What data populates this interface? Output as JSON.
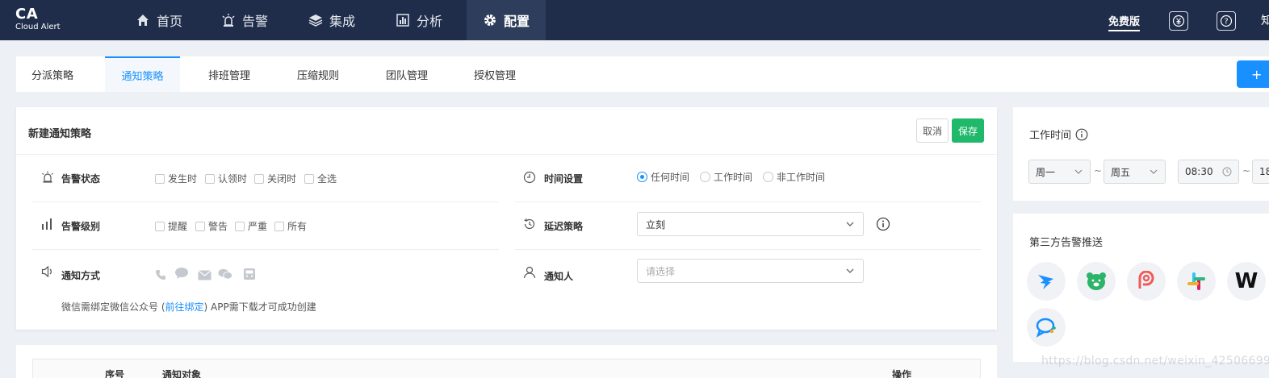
{
  "brand": {
    "title": "CA",
    "subtitle": "Cloud Alert"
  },
  "nav": {
    "items": [
      {
        "label": "首页",
        "icon": "home-icon"
      },
      {
        "label": "告警",
        "icon": "alarm-icon"
      },
      {
        "label": "集成",
        "icon": "layers-icon"
      },
      {
        "label": "分析",
        "icon": "bar-chart-icon"
      },
      {
        "label": "配置",
        "icon": "gear-icon",
        "active": true
      }
    ],
    "plan_label": "免费版",
    "edge_glyph": "知"
  },
  "tabs": [
    {
      "label": "分派策略"
    },
    {
      "label": "通知策略",
      "active": true
    },
    {
      "label": "排班管理"
    },
    {
      "label": "压缩规则"
    },
    {
      "label": "团队管理"
    },
    {
      "label": "授权管理"
    }
  ],
  "add_button": "+",
  "form": {
    "title": "新建通知策略",
    "cancel": "取消",
    "save": "保存",
    "alert_status": {
      "label": "告警状态",
      "options": [
        "发生时",
        "认领时",
        "关闭时",
        "全选"
      ]
    },
    "alert_level": {
      "label": "告警级别",
      "options": [
        "提醒",
        "警告",
        "严重",
        "所有"
      ]
    },
    "notify_method": {
      "label": "通知方式",
      "methods": [
        "phone-icon",
        "sms-icon",
        "email-icon",
        "wechat-icon",
        "app-icon"
      ]
    },
    "time_setting": {
      "label": "时间设置",
      "options": [
        "任何时间",
        "工作时间",
        "非工作时间"
      ],
      "selected": "任何时间"
    },
    "delay_policy": {
      "label": "延迟策略",
      "value": "立刻"
    },
    "notify_person": {
      "label": "通知人",
      "placeholder": "请选择"
    },
    "note": {
      "before": "微信需绑定微信公众号 (",
      "link": "前往绑定",
      "after": ") APP需下载才可成功创建"
    }
  },
  "table": {
    "headers": [
      "序号",
      "通知对象",
      "操作"
    ]
  },
  "work_time": {
    "title": "工作时间",
    "day_from": "周一",
    "day_to": "周五",
    "time_from": "08:30",
    "time_to_partial": "18",
    "separator": "~"
  },
  "third_party": {
    "title": "第三方告警推送",
    "apps": [
      {
        "name": "dingtalk-icon",
        "color": "#1890ff"
      },
      {
        "name": "bear-icon",
        "color": "#2db36a"
      },
      {
        "name": "feishu-icon",
        "color": "#f05a5a"
      },
      {
        "name": "slack-icon",
        "color": "#e01e5a"
      },
      {
        "name": "w-letter-icon",
        "label": "W",
        "color": "#111111"
      },
      {
        "name": "chat-bubble-icon",
        "color": "#1890ff"
      }
    ]
  },
  "watermark": "https://blog.csdn.net/weixin_42506699"
}
